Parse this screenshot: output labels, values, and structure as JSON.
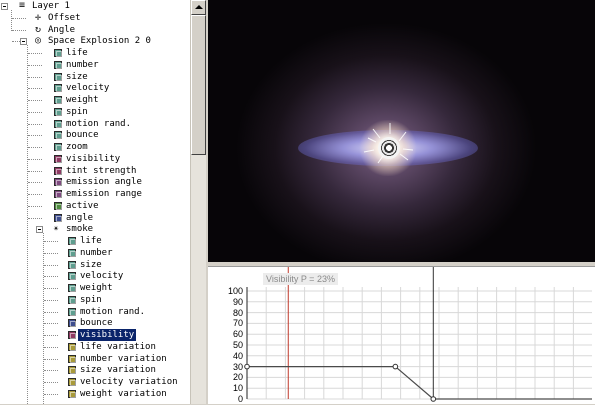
{
  "tree": {
    "rows": [
      {
        "label": "Layer 1",
        "icon": "list-icon",
        "indent": 0,
        "expander": true
      },
      {
        "label": "Offset",
        "icon": "move-icon",
        "indent": 1
      },
      {
        "label": "Angle",
        "icon": "rotate-icon",
        "indent": 1
      },
      {
        "label": "Space Explosion 2 0",
        "icon": "target-icon",
        "indent": 1,
        "expander": true
      },
      {
        "label": "life",
        "icon": "param-icon",
        "color": "#5f9e8f",
        "indent": 2
      },
      {
        "label": "number",
        "icon": "param-icon",
        "color": "#5f9e8f",
        "indent": 2
      },
      {
        "label": "size",
        "icon": "param-icon",
        "color": "#5f9e8f",
        "indent": 2
      },
      {
        "label": "velocity",
        "icon": "param-icon",
        "color": "#5f9e8f",
        "indent": 2
      },
      {
        "label": "weight",
        "icon": "param-icon",
        "color": "#5f9e8f",
        "indent": 2
      },
      {
        "label": "spin",
        "icon": "param-icon",
        "color": "#5f9e8f",
        "indent": 2
      },
      {
        "label": "motion rand.",
        "icon": "param-icon",
        "color": "#5f9e8f",
        "indent": 2
      },
      {
        "label": "bounce",
        "icon": "param-icon",
        "color": "#5f9e8f",
        "indent": 2
      },
      {
        "label": "zoom",
        "icon": "param-icon",
        "color": "#5f9e8f",
        "indent": 2
      },
      {
        "label": "visibility",
        "icon": "param-icon",
        "color": "#8e3a63",
        "indent": 2
      },
      {
        "label": "tint strength",
        "icon": "param-icon",
        "color": "#8e3a63",
        "indent": 2
      },
      {
        "label": "emission angle",
        "icon": "param-icon",
        "color": "#7e4a7f",
        "indent": 2
      },
      {
        "label": "emission range",
        "icon": "param-icon",
        "color": "#7e4a7f",
        "indent": 2
      },
      {
        "label": "active",
        "icon": "param-icon",
        "color": "#4e8a3e",
        "indent": 2
      },
      {
        "label": "angle",
        "icon": "param-icon",
        "color": "#3e4e8f",
        "indent": 2
      },
      {
        "label": "smoke",
        "icon": "star-icon",
        "indent": 2,
        "expander": true
      },
      {
        "label": "life",
        "icon": "param-icon",
        "color": "#5f9e8f",
        "indent": 3
      },
      {
        "label": "number",
        "icon": "param-icon",
        "color": "#5f9e8f",
        "indent": 3
      },
      {
        "label": "size",
        "icon": "param-icon",
        "color": "#5f9e8f",
        "indent": 3
      },
      {
        "label": "velocity",
        "icon": "param-icon",
        "color": "#5f9e8f",
        "indent": 3
      },
      {
        "label": "weight",
        "icon": "param-icon",
        "color": "#5f9e8f",
        "indent": 3
      },
      {
        "label": "spin",
        "icon": "param-icon",
        "color": "#5f9e8f",
        "indent": 3
      },
      {
        "label": "motion rand.",
        "icon": "param-icon",
        "color": "#5f9e8f",
        "indent": 3
      },
      {
        "label": "bounce",
        "icon": "param-icon",
        "color": "#3e4e8f",
        "indent": 3
      },
      {
        "label": "visibility",
        "icon": "param-icon",
        "color": "#8e3a63",
        "indent": 3,
        "selected": true
      },
      {
        "label": "life variation",
        "icon": "param-icon",
        "color": "#a89a3a",
        "indent": 3
      },
      {
        "label": "number variation",
        "icon": "param-icon",
        "color": "#a89a3a",
        "indent": 3
      },
      {
        "label": "size variation",
        "icon": "param-icon",
        "color": "#a89a3a",
        "indent": 3
      },
      {
        "label": "velocity variation",
        "icon": "param-icon",
        "color": "#a89a3a",
        "indent": 3
      },
      {
        "label": "weight variation",
        "icon": "param-icon",
        "color": "#a89a3a",
        "indent": 3
      }
    ]
  },
  "curve": {
    "label": "Visibility  P = 23%",
    "y_ticks": [
      "100",
      "90",
      "80",
      "70",
      "60",
      "50",
      "40",
      "30",
      "20",
      "10",
      "0"
    ],
    "playhead_percent": 23,
    "points": [
      {
        "x": 0,
        "y": 30
      },
      {
        "x": 43,
        "y": 30
      },
      {
        "x": 54,
        "y": 0
      },
      {
        "x": 100,
        "y": 0
      }
    ],
    "colors": {
      "curve": "#4a4a4a",
      "playhead": "#c0392b",
      "grid": "#d8d8d8",
      "point_fill": "#ffffff"
    }
  }
}
